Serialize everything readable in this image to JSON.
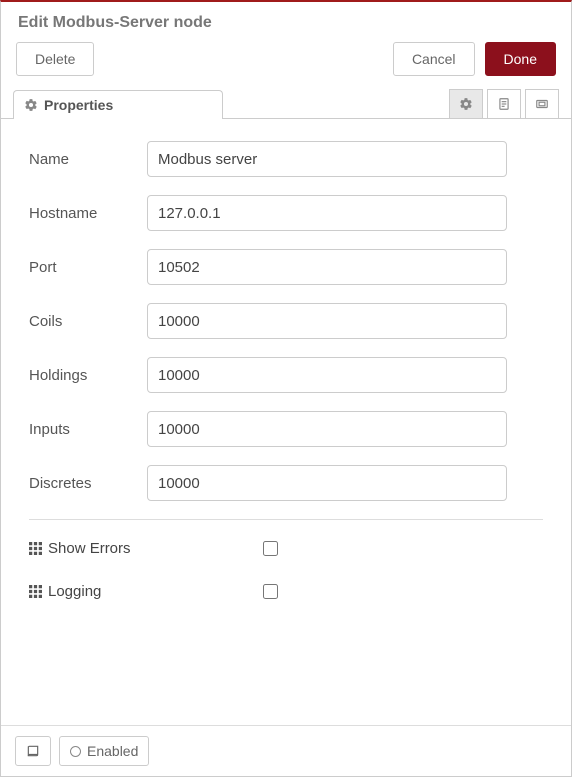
{
  "title": "Edit Modbus-Server node",
  "buttons": {
    "delete": "Delete",
    "cancel": "Cancel",
    "done": "Done"
  },
  "tab": {
    "label": "Properties"
  },
  "fields": {
    "name": {
      "label": "Name",
      "value": "Modbus server"
    },
    "hostname": {
      "label": "Hostname",
      "value": "127.0.0.1"
    },
    "port": {
      "label": "Port",
      "value": "10502"
    },
    "coils": {
      "label": "Coils",
      "value": "10000"
    },
    "holdings": {
      "label": "Holdings",
      "value": "10000"
    },
    "inputs": {
      "label": "Inputs",
      "value": "10000"
    },
    "discretes": {
      "label": "Discretes",
      "value": "10000"
    }
  },
  "checks": {
    "show_errors": {
      "label": "Show Errors",
      "checked": false
    },
    "logging": {
      "label": "Logging",
      "checked": false
    }
  },
  "footer": {
    "enabled": "Enabled"
  }
}
